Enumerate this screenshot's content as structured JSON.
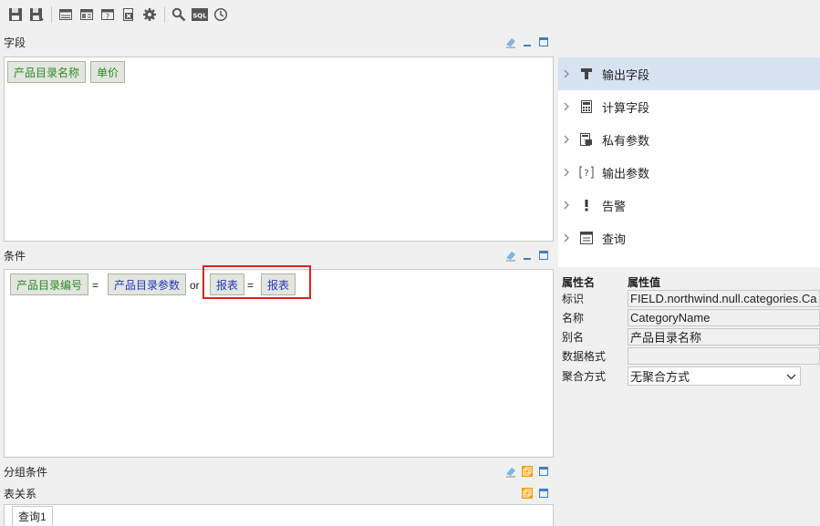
{
  "toolbar": {
    "buttons": [
      {
        "name": "save-icon"
      },
      {
        "name": "save-as-icon"
      },
      {
        "name": "table-view-icon"
      },
      {
        "name": "layout-icon"
      },
      {
        "name": "parameter-icon"
      },
      {
        "name": "export-icon"
      },
      {
        "name": "settings-gear-icon"
      },
      {
        "name": "search-icon"
      },
      {
        "name": "sql-icon",
        "label": "SQL"
      },
      {
        "name": "clock-icon"
      }
    ]
  },
  "fields_section": {
    "title": "字段",
    "chips": [
      "产品目录名称",
      "单价"
    ]
  },
  "conditions_section": {
    "title": "条件",
    "condition1": {
      "left": "产品目录编号",
      "op": "=",
      "right": "产品目录参数"
    },
    "connector": "or",
    "condition2": {
      "left": "报表",
      "op": "=",
      "right": "报表"
    }
  },
  "group_section": {
    "title": "分组条件"
  },
  "relation_section": {
    "title": "表关系"
  },
  "query_tab": {
    "label": "查询1"
  },
  "tree": {
    "items": [
      {
        "label": "输出字段",
        "icon": "output-field-icon",
        "selected": true
      },
      {
        "label": "计算字段",
        "icon": "calc-field-icon",
        "selected": false
      },
      {
        "label": "私有参数",
        "icon": "private-param-icon",
        "selected": false
      },
      {
        "label": "输出参数",
        "icon": "output-param-icon",
        "selected": false
      },
      {
        "label": "告警",
        "icon": "alert-icon",
        "selected": false
      },
      {
        "label": "查询",
        "icon": "query-icon",
        "selected": false
      }
    ]
  },
  "properties": {
    "header_name": "属性名",
    "header_value": "属性值",
    "rows": [
      {
        "label": "标识",
        "value": "FIELD.northwind.null.categories.Ca"
      },
      {
        "label": "名称",
        "value": "CategoryName"
      },
      {
        "label": "别名",
        "value": "产品目录名称"
      },
      {
        "label": "数据格式",
        "value": ""
      },
      {
        "label": "聚合方式",
        "value": "无聚合方式"
      }
    ]
  },
  "colors": {
    "green_text": "#2a8a25",
    "blue_text": "#2434b8",
    "highlight": "#e02020",
    "selected_bg": "#d8e3f2"
  }
}
